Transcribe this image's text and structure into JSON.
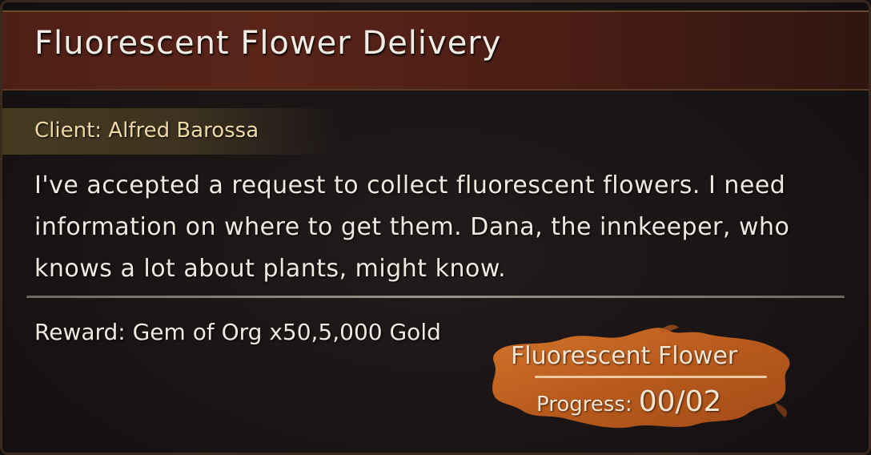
{
  "quest": {
    "title": "Fluorescent Flower Delivery",
    "client": "Client: Alfred Barossa",
    "description": "I've accepted a request to collect fluorescent flowers. I need information on where to get them. Dana, the innkeeper, who knows a lot about plants, might know.",
    "reward": "Reward: Gem of Org x50,5,000 Gold"
  },
  "objective": {
    "name": "Fluorescent Flower",
    "progress_label": "Progress:",
    "progress_value": "00/02",
    "progress_current": 0,
    "progress_total": 2
  },
  "colors": {
    "title_bar": "#5a2419",
    "client_bar": "#463a21",
    "splash": "#c3631f",
    "text": "#efe9e1",
    "client_text": "#efd9a6"
  }
}
